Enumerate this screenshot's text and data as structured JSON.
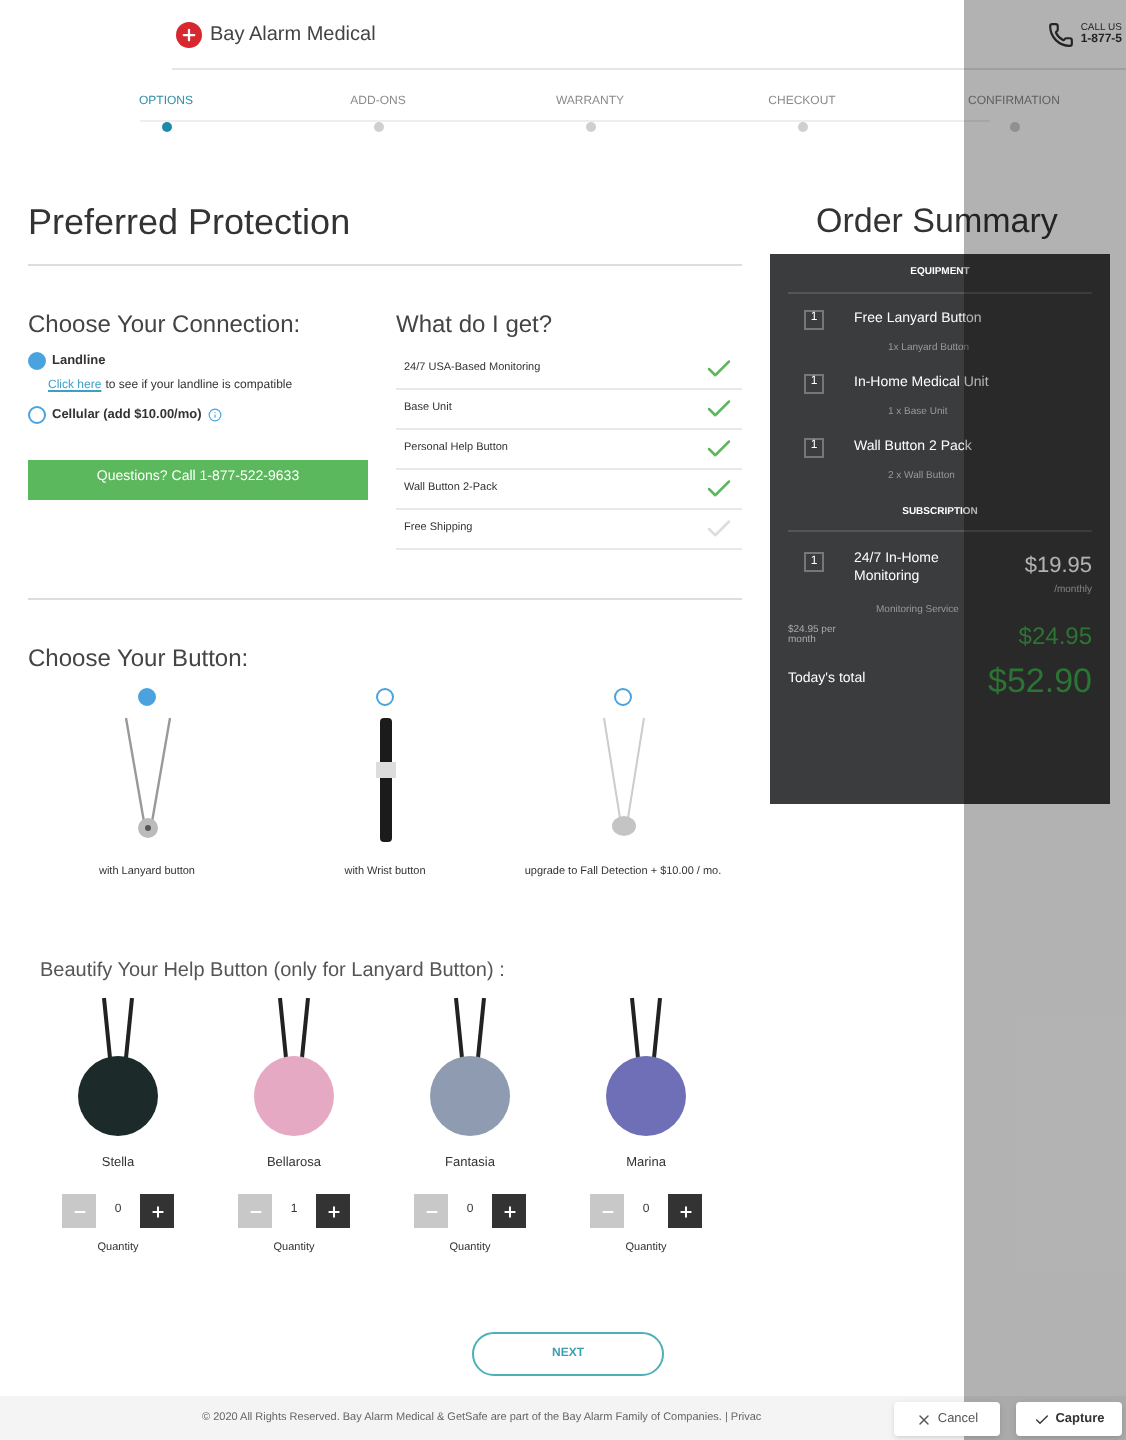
{
  "header": {
    "brand": "Bay Alarm Medical",
    "call_label": "CALL US",
    "call_number": "1-877-5"
  },
  "steps": [
    {
      "label": "OPTIONS",
      "selected": true
    },
    {
      "label": "ADD-ONS",
      "selected": false
    },
    {
      "label": "WARRANTY",
      "selected": false
    },
    {
      "label": "CHECKOUT",
      "selected": false
    },
    {
      "label": "CONFIRMATION",
      "selected": false
    }
  ],
  "title": "Preferred Protection",
  "connection": {
    "heading": "Choose Your Connection:",
    "options": [
      {
        "label": "Landline",
        "selected": true,
        "info": false
      },
      {
        "label": "Cellular (add $10.00/mo)",
        "selected": false,
        "info": true
      }
    ],
    "link": "Click here",
    "link_note": "to see if your landline is compatible",
    "call_button": "Questions? Call 1-877-522-9633"
  },
  "benefits": {
    "heading": "What do I get?",
    "items": [
      {
        "label": "24/7 USA-Based Monitoring",
        "included": true
      },
      {
        "label": "Base Unit",
        "included": true
      },
      {
        "label": "Personal Help Button",
        "included": true
      },
      {
        "label": "Wall Button 2-Pack",
        "included": true
      },
      {
        "label": "Free Shipping",
        "included": false
      }
    ]
  },
  "buttons": {
    "heading": "Choose Your Button:",
    "options": [
      {
        "kind": "lanyard",
        "label": "with Lanyard button",
        "selected": true
      },
      {
        "kind": "wrist",
        "label": "with Wrist button",
        "selected": false
      },
      {
        "kind": "fall",
        "label": "upgrade to Fall Detection + $10.00 / mo.",
        "selected": false
      }
    ]
  },
  "beautify": {
    "heading": "Beautify Your Help Button (only for Lanyard Button) :",
    "items": [
      {
        "name": "Stella",
        "quantity": "0",
        "quantity_label": "Quantity",
        "color": "#1d2a2a"
      },
      {
        "name": "Bellarosa",
        "quantity": "1",
        "quantity_label": "Quantity",
        "color": "#e6a9c4"
      },
      {
        "name": "Fantasia",
        "quantity": "0",
        "quantity_label": "Quantity",
        "color": "#8f9bb0"
      },
      {
        "name": "Marina",
        "quantity": "0",
        "quantity_label": "Quantity",
        "color": "#6f6fb8"
      }
    ]
  },
  "next_button": "NEXT",
  "summary": {
    "title": "Order Summary",
    "equipment_heading": "EQUIPMENT",
    "equipment": [
      {
        "qty": "1",
        "name": "Free Lanyard Button",
        "detail": "1x Lanyard Button"
      },
      {
        "qty": "1",
        "name": "In-Home Medical Unit",
        "detail": "1 x Base Unit"
      },
      {
        "qty": "1",
        "name": "Wall Button 2 Pack",
        "detail": "2 x Wall Button"
      }
    ],
    "subscription_heading": "SUBSCRIPTION",
    "subscription": [
      {
        "qty": "1",
        "name": "24/7 In-Home Monitoring",
        "price": "$19.95",
        "period": "/monthly",
        "detail": "Monitoring Service"
      }
    ],
    "monthly_label": "$24.95 per month",
    "monthly_total": "$24.95",
    "today_label": "Today's total",
    "today_total": "$52.90"
  },
  "footer": "© 2020 All Rights Reserved. Bay Alarm Medical & GetSafe are part of the Bay Alarm Family of Companies. |  Privac",
  "capture_bar": {
    "cancel": "Cancel",
    "capture": "Capture"
  }
}
